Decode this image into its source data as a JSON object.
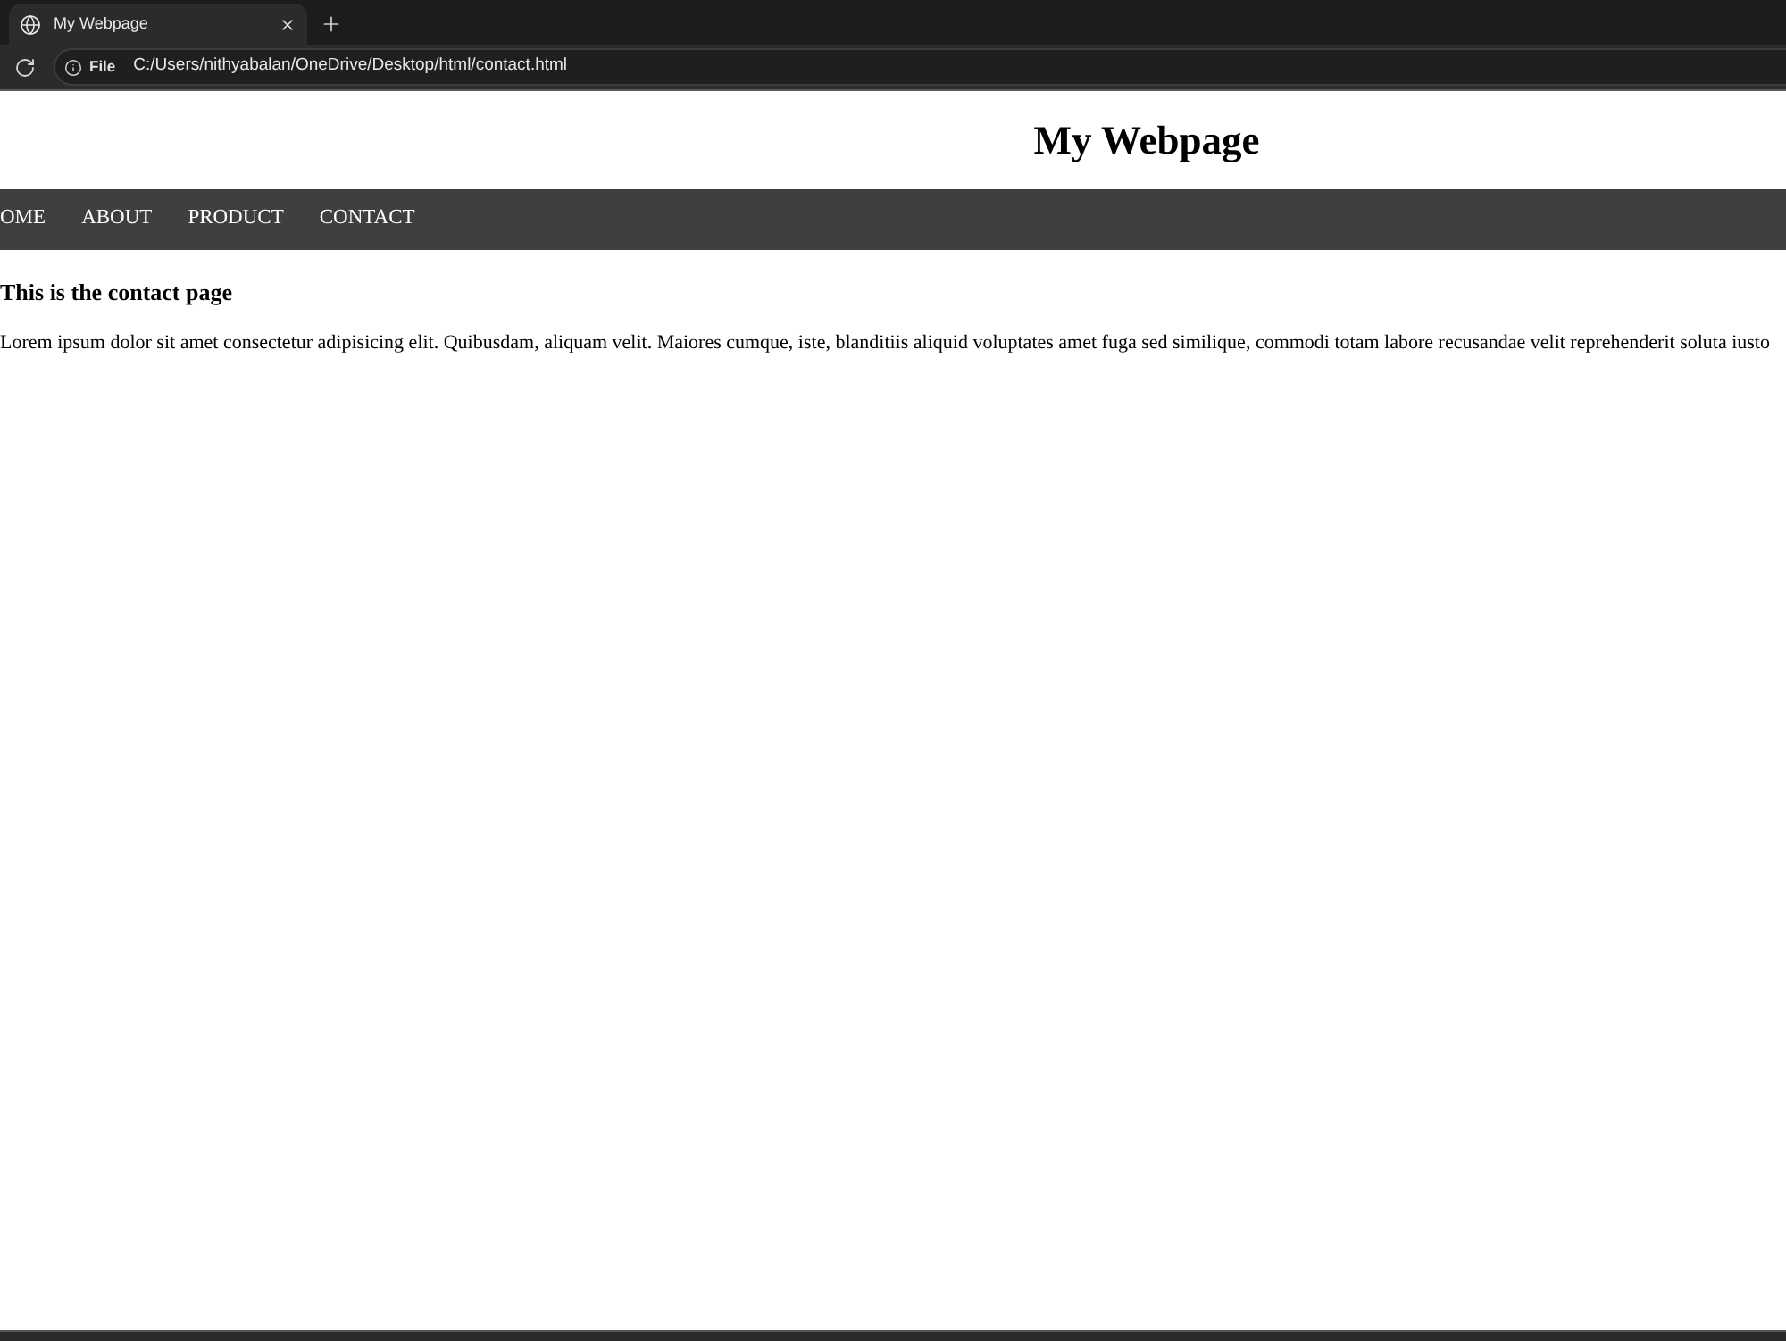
{
  "browser": {
    "tabs": [
      {
        "title": "My Webpage",
        "selected": true
      }
    ],
    "address_bar": {
      "scheme_label": "File",
      "url": "C:/Users/nithyabalan/OneDrive/Desktop/html/contact.html"
    }
  },
  "page": {
    "title": "My Webpage",
    "nav": [
      "OME",
      "ABOUT",
      "PRODUCT",
      "CONTACT"
    ],
    "heading": "This is the contact page",
    "paragraph": "Lorem ipsum dolor sit amet consectetur adipisicing elit. Quibusdam, aliquam velit. Maiores cumque, iste, blanditiis aliquid voluptates amet fuga sed similique, commodi totam labore recusandae velit reprehenderit soluta iusto"
  }
}
